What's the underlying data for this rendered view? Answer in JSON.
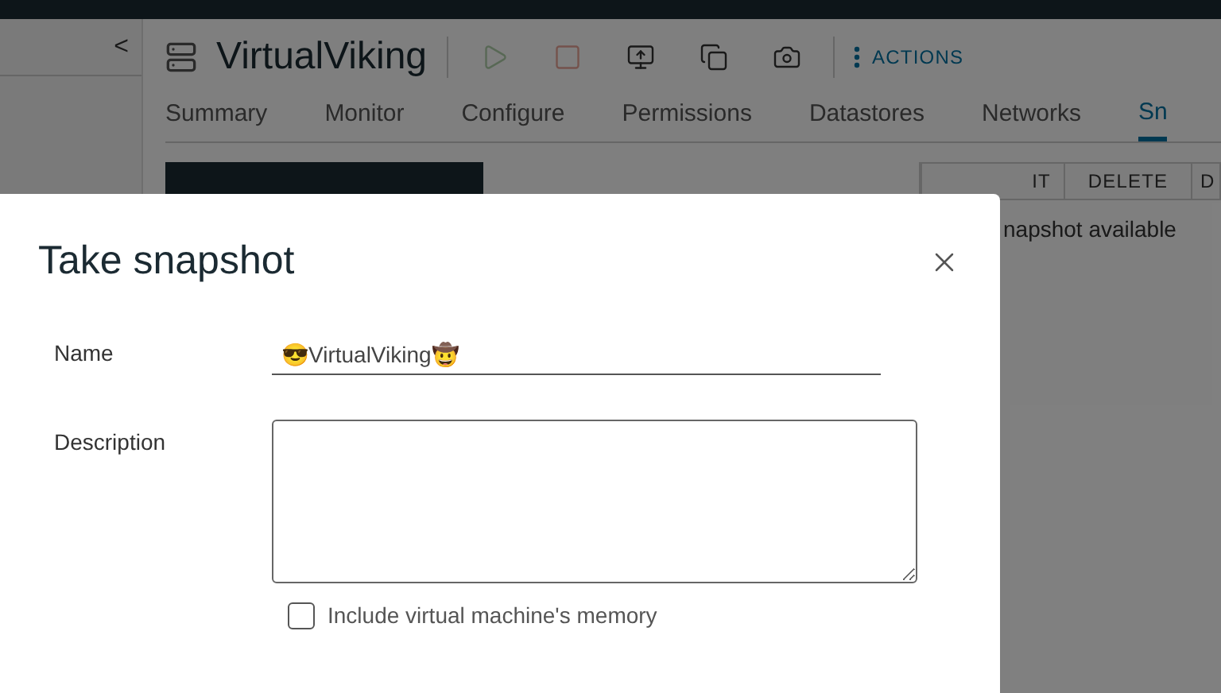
{
  "sidebar": {
    "collapse": "<"
  },
  "header": {
    "title": "VirtualViking",
    "actions_label": "ACTIONS"
  },
  "toolbar": [
    {
      "kind": "play",
      "disabled": true
    },
    {
      "kind": "stop",
      "disabled": true
    },
    {
      "kind": "console",
      "disabled": false
    },
    {
      "kind": "migrate",
      "disabled": false
    },
    {
      "kind": "snapshot",
      "disabled": false
    }
  ],
  "tabs": [
    {
      "label": "Summary",
      "selected": false
    },
    {
      "label": "Monitor",
      "selected": false
    },
    {
      "label": "Configure",
      "selected": false
    },
    {
      "label": "Permissions",
      "selected": false
    },
    {
      "label": "Datastores",
      "selected": false
    },
    {
      "label": "Networks",
      "selected": false
    },
    {
      "label": "Sn",
      "selected": true
    }
  ],
  "table": {
    "columns": [
      "IT",
      "DELETE",
      "D"
    ],
    "empty_text": "napshot available"
  },
  "dialog": {
    "title": "Take snapshot",
    "fields": [
      {
        "kind": "text",
        "label": "Name",
        "value": "😎VirtualViking🤠"
      },
      {
        "kind": "textarea",
        "label": "Description"
      }
    ],
    "options": [
      {
        "label": "Include virtual machine's memory",
        "checked": false
      }
    ]
  }
}
